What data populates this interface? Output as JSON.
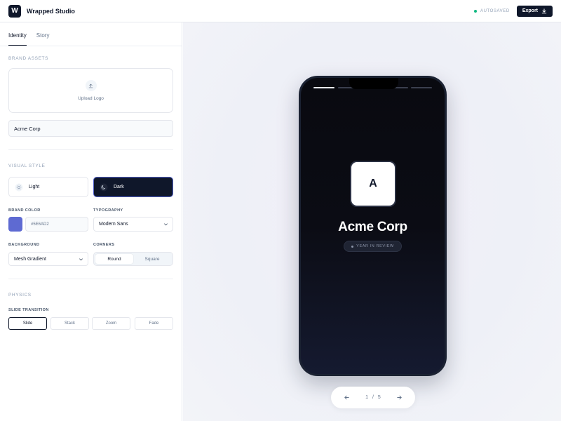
{
  "app": {
    "logo_letter": "W",
    "title": "Wrapped Studio"
  },
  "header": {
    "autosave": "AUTOSAVED",
    "export_label": "Export",
    "autosave_color": "#10b981"
  },
  "tabs": [
    {
      "label": "Identity",
      "active": true
    },
    {
      "label": "Story",
      "active": false
    }
  ],
  "brand_assets": {
    "section": "BRAND ASSETS",
    "upload_label": "Upload Logo",
    "brand_name_value": "Acme Corp"
  },
  "visual_style": {
    "section": "VISUAL STYLE",
    "options": [
      {
        "label": "Light",
        "selected": false
      },
      {
        "label": "Dark",
        "selected": true
      }
    ],
    "brand_color_label": "BRAND COLOR",
    "brand_color_value": "#5E6AD2",
    "typography_label": "TYPOGRAPHY",
    "typography_value": "Modern Sans",
    "background_label": "BACKGROUND",
    "background_value": "Mesh Gradient",
    "corners_label": "CORNERS",
    "corners_options": [
      "Round",
      "Square"
    ],
    "corners_selected": "Round"
  },
  "physics": {
    "section": "PHYSICS",
    "transition_label": "SLIDE TRANSITION",
    "transitions": [
      "Slide",
      "Stack",
      "Zoom",
      "Fade"
    ],
    "selected": "Slide"
  },
  "preview": {
    "icon_letter": "A",
    "brand_name": "Acme Corp",
    "tagline": "YEAR IN REVIEW",
    "progress_active": 1,
    "progress_total": 5,
    "pager": {
      "current": "1",
      "separator": "/",
      "total": "5"
    }
  },
  "colors": {
    "accent": "#5E6AD2",
    "dark": "#0f172a"
  }
}
